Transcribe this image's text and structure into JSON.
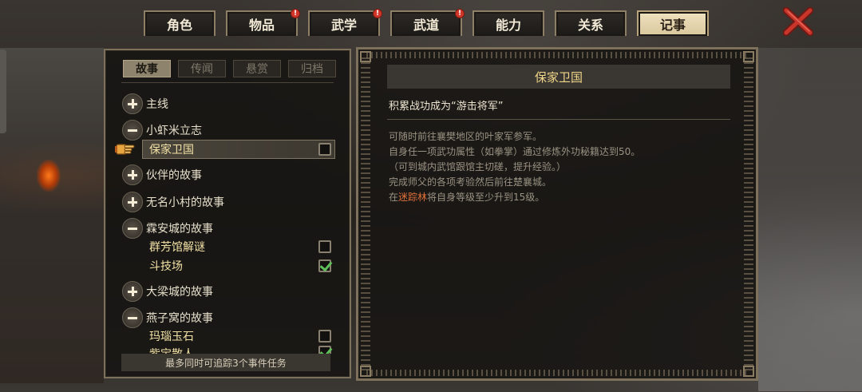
{
  "tabs": [
    {
      "label": "角色",
      "alert": false,
      "active": false
    },
    {
      "label": "物品",
      "alert": true,
      "active": false
    },
    {
      "label": "武学",
      "alert": true,
      "active": false
    },
    {
      "label": "武道",
      "alert": true,
      "active": false
    },
    {
      "label": "能力",
      "alert": false,
      "active": false
    },
    {
      "label": "关系",
      "alert": false,
      "active": false
    },
    {
      "label": "记事",
      "alert": false,
      "active": true
    }
  ],
  "alert_glyph": "!",
  "subtabs": [
    "故事",
    "传闻",
    "悬赏",
    "归档"
  ],
  "active_subtab": "故事",
  "tree": {
    "main_line": "主线",
    "xiaxia": "小虾米立志",
    "xiaxia_child": "保家卫国",
    "partner": "伙伴的故事",
    "village": "无名小村的故事",
    "linan": "霖安城的故事",
    "linan_child1": "群芳馆解谜",
    "linan_child2": "斗技场",
    "daliang": "大梁城的故事",
    "yanziwo": "燕子窝的故事",
    "yanziwo_child1": "玛瑙玉石",
    "yanziwo_child2_partial": "紫宝散人"
  },
  "checks": {
    "xiaxia_child": false,
    "linan_child1": false,
    "linan_child2": true,
    "yanziwo_child1": false,
    "yanziwo_child2": true
  },
  "footer": "最多同时可追踪3个事件任务",
  "quest": {
    "title": "保家卫国",
    "subtitle": "积累战功成为“游击将军”",
    "line1": "可随时前往襄樊地区的叶家军参军。",
    "line2": "自身任一项武功属性（如拳掌）通过修炼外功秘籍达到50。",
    "line3": "（可到城内武馆跟馆主切磋，提升经验。）",
    "line4": "完成师父的各项考验然后前往楚襄城。",
    "line5_pre": "在",
    "line5_highlight": "迷踪林",
    "line5_post": "将自身等级至少升到15级。"
  },
  "colors": {
    "highlight": "#e2713a",
    "title": "#f0d68a",
    "check": "#5fc05a",
    "close": "#c8352b"
  }
}
